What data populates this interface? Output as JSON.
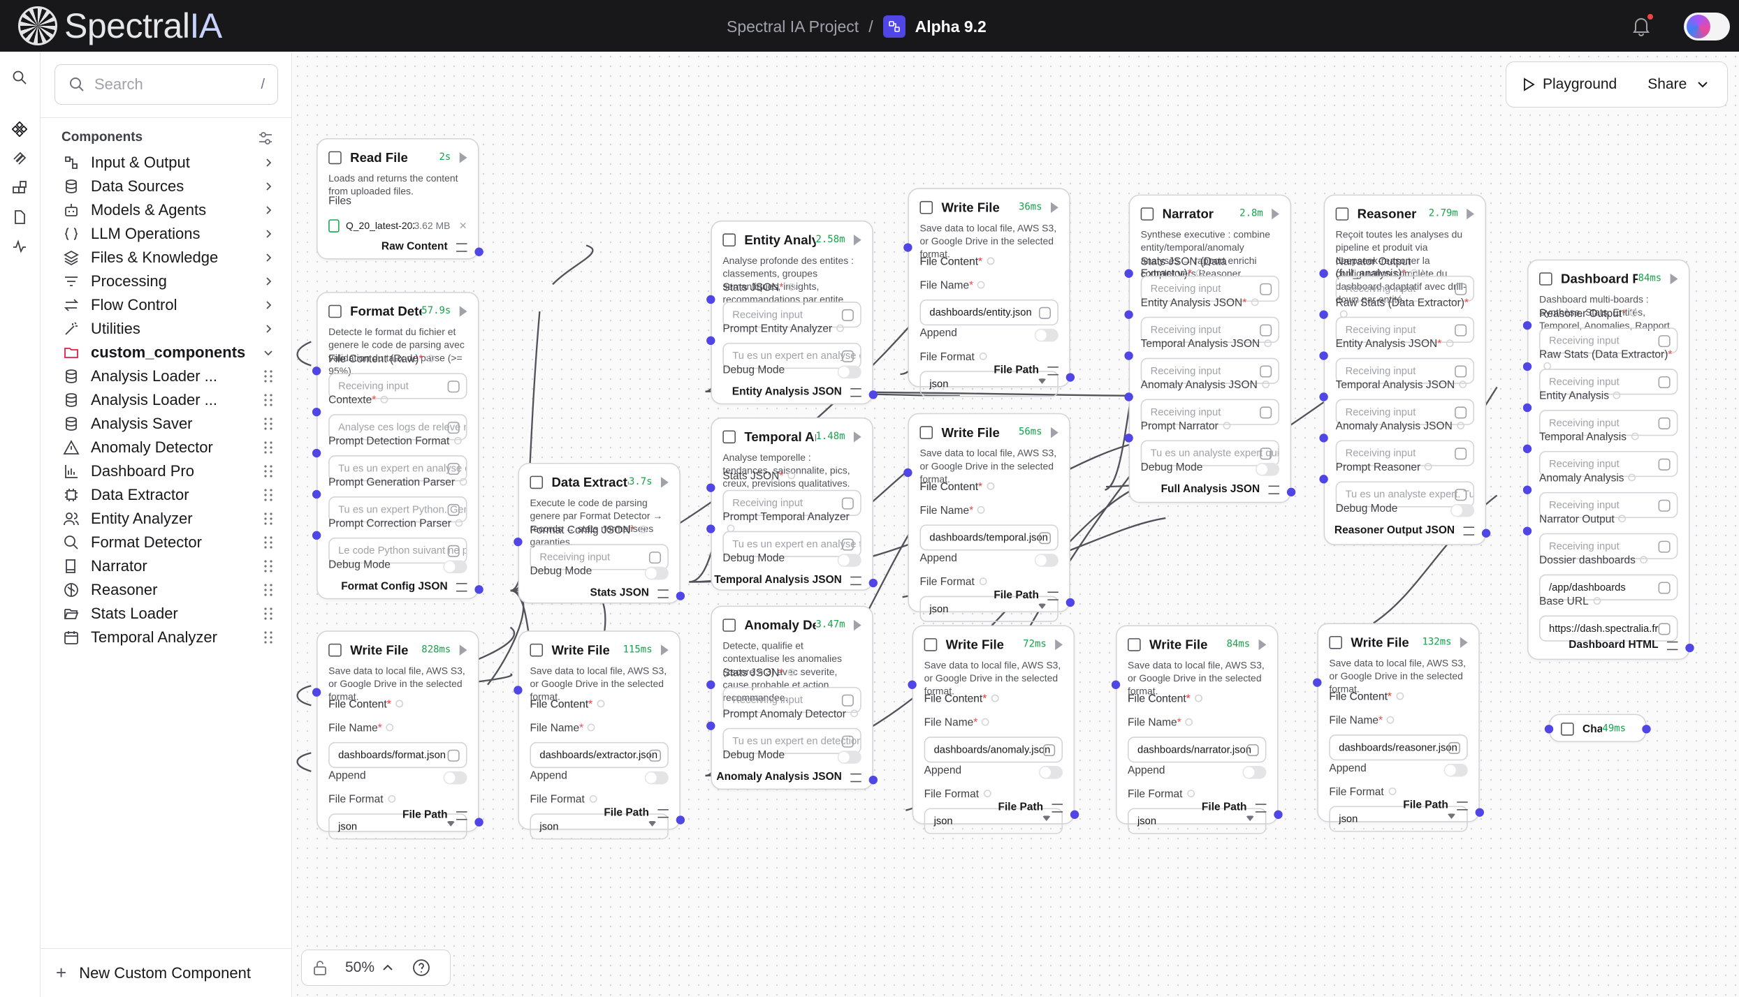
{
  "app": {
    "logo_a": "Spectral",
    "logo_b": "IA",
    "project_name": "Spectral IA Project",
    "separator": "/",
    "flow_name": "Alpha 9.2"
  },
  "colors": {
    "accent": "#4f46e5",
    "topbar": "#18181b",
    "time_green": "#16a34a",
    "required": "#ef4444"
  },
  "search": {
    "placeholder": "Search",
    "shortcut": "/"
  },
  "sidebar": {
    "header": "Components",
    "categories": [
      {
        "label": "Input & Output",
        "icon": "input-output-icon"
      },
      {
        "label": "Data Sources",
        "icon": "database-icon"
      },
      {
        "label": "Models & Agents",
        "icon": "bot-icon"
      },
      {
        "label": "LLM Operations",
        "icon": "braces-icon"
      },
      {
        "label": "Files & Knowledge",
        "icon": "layers-icon"
      },
      {
        "label": "Processing",
        "icon": "filter-icon"
      },
      {
        "label": "Flow Control",
        "icon": "arrows-icon"
      },
      {
        "label": "Utilities",
        "icon": "wand-icon"
      },
      {
        "label": "custom_components",
        "icon": "folder-icon"
      }
    ],
    "custom": [
      {
        "label": "Analysis Loader ...",
        "icon": "database-icon"
      },
      {
        "label": "Analysis Loader ...",
        "icon": "database-icon"
      },
      {
        "label": "Analysis Saver",
        "icon": "database-icon"
      },
      {
        "label": "Anomaly Detector",
        "icon": "warning-icon"
      },
      {
        "label": "Dashboard Pro",
        "icon": "chart-icon"
      },
      {
        "label": "Data Extractor",
        "icon": "chip-icon"
      },
      {
        "label": "Entity Analyzer",
        "icon": "users-icon"
      },
      {
        "label": "Format Detector",
        "icon": "search-icon"
      },
      {
        "label": "Narrator",
        "icon": "book-icon"
      },
      {
        "label": "Reasoner",
        "icon": "brain-icon"
      },
      {
        "label": "Stats Loader",
        "icon": "folder-open-icon"
      },
      {
        "label": "Temporal Analyzer",
        "icon": "calendar-icon"
      }
    ],
    "new_component": "New Custom Component"
  },
  "toolbar": {
    "playground": "Playground",
    "share": "Share"
  },
  "zoom": {
    "level": "50%"
  },
  "labels": {
    "receiving": "Receiving input",
    "debug": "Debug Mode",
    "file_content": "File Content",
    "file_name": "File Name",
    "append": "Append",
    "file_format": "File Format",
    "file_path": "File Path",
    "json": "json",
    "stats_json": "Stats JSON",
    "write_desc": "Save data to local file, AWS S3, or Google Drive in the selected format.",
    "write_title": "Write File",
    "star": "*"
  },
  "nodes": {
    "read_file": {
      "title": "Read File",
      "time": "2s",
      "desc": "Loads and returns the content from uploaded files.",
      "files_label": "Files",
      "file_name": "Q_20_latest-2025-20...",
      "file_size": "3.62 MB",
      "output": "Raw Content"
    },
    "format_detector": {
      "title": "Format Detector",
      "time": "57.9s",
      "desc": "Detecte le format du fichier et genere le code de parsing avec validation du taux de parse (>= 95%).",
      "f1": "File Content (Raw)",
      "f2": "Contexte",
      "f2_val": "Analyse ces logs de relevé mesu",
      "f3": "Prompt Detection Format",
      "f3_val": "Tu es un expert en analyse de fichi",
      "f4": "Prompt Generation Parser",
      "f4_val": "Tu es un expert Python. Genere d",
      "f5": "Prompt Correction Parser",
      "f5_val": "Le code Python suivant ne parse p",
      "output": "Format Config JSON"
    },
    "wf_format": {
      "time": "828ms",
      "name": "dashboards/format.json"
    },
    "data_extractor": {
      "title": "Data Extractor",
      "time": "3.7s",
      "desc": "Execute le code de parsing genere par Format Detector → records → stats normalisees garanties.",
      "f1": "Format Config JSON",
      "output": "Stats JSON"
    },
    "wf_extractor": {
      "time": "115ms",
      "name": "dashboards/extractor.json"
    },
    "entity": {
      "title": "Entity Analyzer",
      "time": "2.58m",
      "desc": "Analyse profonde des entites : classements, groupes semantiques, insights, recommandations par entite.",
      "f2": "Prompt Entity Analyzer",
      "f2_val": "Tu es un expert en analyse de do",
      "output": "Entity Analysis JSON"
    },
    "temporal": {
      "title": "Temporal Analyzer",
      "time": "1.48m",
      "desc": "Analyse temporelle : tendances, saisonnalite, pics, creux, previsions qualitatives.",
      "f2": "Prompt Temporal Analyzer",
      "f2_val": "Tu es un expert en analyse tempo",
      "output": "Temporal Analysis JSON"
    },
    "anomaly": {
      "title": "Anomaly Detector",
      "time": "3.47m",
      "desc": "Detecte, qualifie et contextualise les anomalies (zscore > 3) avec severite, cause probable et action recommandee.",
      "f2": "Prompt Anomaly Detector",
      "f2_val": "Tu es un expert en detection d'ano",
      "output": "Anomaly Analysis JSON"
    },
    "wf_entity": {
      "time": "36ms",
      "name": "dashboards/entity.json"
    },
    "wf_temporal": {
      "time": "56ms",
      "name": "dashboards/temporal.json"
    },
    "wf_anomaly": {
      "time": "72ms",
      "name": "dashboards/anomaly.json"
    },
    "narrator": {
      "title": "Narrator",
      "time": "2.8m",
      "desc": "Synthese executive : combine entity/temporal/anomaly analyses → rapport enrichi complet vers Reasoner.",
      "f1": "Stats JSON (Data Extractor)",
      "f2": "Entity Analysis JSON",
      "f3": "Temporal Analysis JSON",
      "f4": "Anomaly Analysis JSON",
      "f5": "Prompt Narrator",
      "f5_val": "Tu es un analyste expert qui synth",
      "output": "Full Analysis JSON"
    },
    "wf_narrator": {
      "time": "84ms",
      "name": "dashboards/narrator.json"
    },
    "reasoner": {
      "title": "Reasoner",
      "time": "2.79m",
      "desc": "Reçoit toutes les analyses du pipeline et produit via deepseek-reasoner la configuration complète du dashboard adaptatif avec drill-down par entité.",
      "f1": "Narrator Output (full_analysis)",
      "f2": "Raw Stats (Data Extractor)",
      "f3": "Entity Analysis JSON",
      "f4": "Temporal Analysis JSON",
      "f5": "Anomaly Analysis JSON",
      "f6": "Prompt Reasoner",
      "f6_val": "Tu es un analyste expert. Tu reço",
      "output": "Reasoner Output JSON"
    },
    "wf_reasoner": {
      "time": "132ms",
      "name": "dashboards/reasoner.json"
    },
    "dashboard": {
      "title": "Dashboard Pro",
      "time": "84ms",
      "desc": "Dashboard multi-boards : Synthèse, Stats, Entités, Temporel, Anomalies, Rapport",
      "f1": "Reasoner Output",
      "f2": "Raw Stats (Data Extractor)",
      "f3": "Entity Analysis",
      "f4": "Temporal Analysis",
      "f5": "Anomaly Analysis",
      "f6": "Narrator Output",
      "f7": "Dossier dashboards",
      "f7_val": "/app/dashboards",
      "f8": "Base URL",
      "f8_val": "https://dash.spectralia.fr",
      "output": "Dashboard HTML"
    },
    "chat": {
      "title": "Chat O...",
      "time": "49ms"
    }
  }
}
